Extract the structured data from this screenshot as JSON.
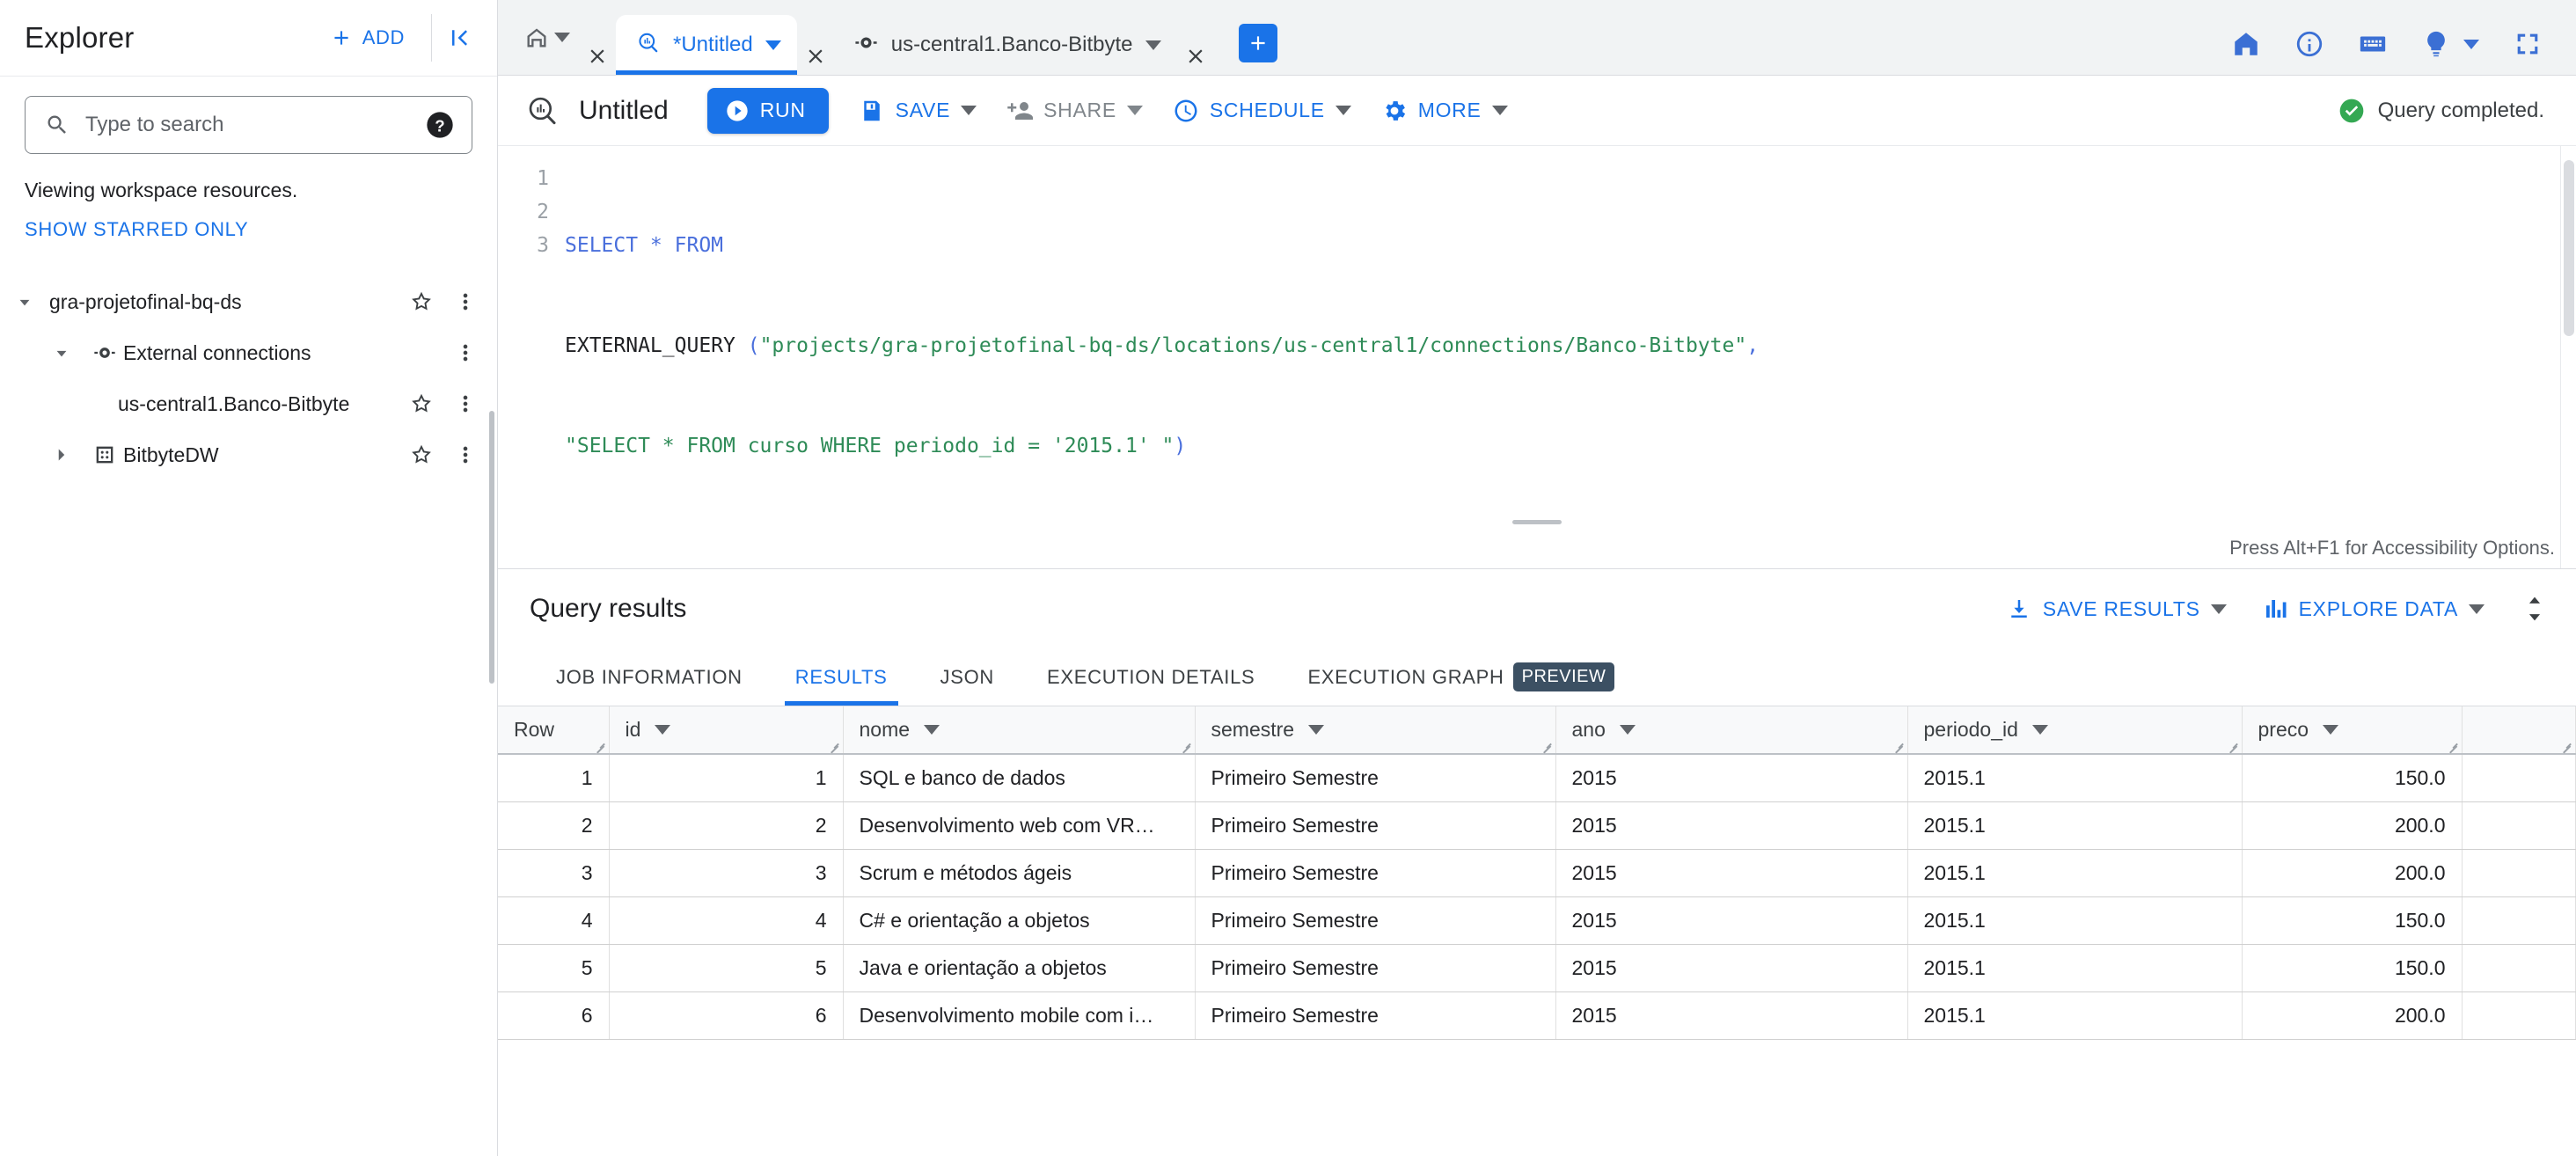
{
  "sidebar": {
    "title": "Explorer",
    "add_label": "ADD",
    "search_placeholder": "Type to search",
    "search_value": "",
    "viewing_note": "Viewing workspace resources.",
    "starred_link": "SHOW STARRED ONLY",
    "tree": [
      {
        "label": "gra-projetofinal-bq-ds",
        "icon": "chevron-down-icon",
        "expanded": true,
        "starred": true,
        "has_menu": true,
        "type": "project"
      },
      {
        "label": "External connections",
        "icon": "connection-icon",
        "expanded": true,
        "starred": false,
        "has_menu": true,
        "type": "folder"
      },
      {
        "label": "us-central1.Banco-Bitbyte",
        "icon": "none",
        "expanded": false,
        "starred": true,
        "has_menu": true,
        "type": "connection"
      },
      {
        "label": "BitbyteDW",
        "icon": "dataset-icon",
        "expanded": false,
        "starred": true,
        "has_menu": true,
        "type": "dataset"
      }
    ]
  },
  "tabstrip": {
    "home_tab_icon": "home-icon",
    "tabs": [
      {
        "label": "*Untitled",
        "icon": "query-icon",
        "active": true,
        "closable": true
      },
      {
        "label": "us-central1.Banco-Bitbyte",
        "icon": "connection-icon",
        "active": false,
        "closable": true
      }
    ],
    "new_tab_label": "+",
    "right_icons": [
      "home-icon",
      "info-icon",
      "keyboard-icon",
      "lightbulb-icon",
      "fullscreen-icon"
    ]
  },
  "toolbar": {
    "query_title": "Untitled",
    "run_label": "RUN",
    "save_label": "SAVE",
    "share_label": "SHARE",
    "schedule_label": "SCHEDULE",
    "more_label": "MORE",
    "status_text": "Query completed.",
    "status_color": "#34a853"
  },
  "editor": {
    "accessibility_hint": "Press Alt+F1 for Accessibility Options.",
    "lines": [
      {
        "num": "1",
        "text": "SELECT * FROM"
      },
      {
        "num": "2",
        "text": "EXTERNAL_QUERY (\"projects/gra-projetofinal-bq-ds/locations/us-central1/connections/Banco-Bitbyte\","
      },
      {
        "num": "3",
        "text": "\"SELECT * FROM curso WHERE periodo_id = '2015.1' \")"
      }
    ],
    "full_query": "SELECT * FROM\nEXTERNAL_QUERY (\"projects/gra-projetofinal-bq-ds/locations/us-central1/connections/Banco-Bitbyte\",\n\"SELECT * FROM curso WHERE periodo_id = '2015.1' \")"
  },
  "results": {
    "title": "Query results",
    "save_results_label": "SAVE RESULTS",
    "explore_data_label": "EXPLORE DATA",
    "tabs": [
      {
        "label": "JOB INFORMATION",
        "active": false,
        "badge": ""
      },
      {
        "label": "RESULTS",
        "active": true,
        "badge": ""
      },
      {
        "label": "JSON",
        "active": false,
        "badge": ""
      },
      {
        "label": "EXECUTION DETAILS",
        "active": false,
        "badge": ""
      },
      {
        "label": "EXECUTION GRAPH",
        "active": false,
        "badge": "PREVIEW"
      }
    ],
    "columns": [
      "Row",
      "id",
      "nome",
      "semestre",
      "ano",
      "periodo_id",
      "preco"
    ],
    "rows": [
      {
        "row": "1",
        "id": "1",
        "nome": "SQL e banco de dados",
        "semestre": "Primeiro Semestre",
        "ano": "2015",
        "periodo_id": "2015.1",
        "preco": "150.0"
      },
      {
        "row": "2",
        "id": "2",
        "nome": "Desenvolvimento web com VR…",
        "semestre": "Primeiro Semestre",
        "ano": "2015",
        "periodo_id": "2015.1",
        "preco": "200.0"
      },
      {
        "row": "3",
        "id": "3",
        "nome": "Scrum e métodos ágeis",
        "semestre": "Primeiro Semestre",
        "ano": "2015",
        "periodo_id": "2015.1",
        "preco": "200.0"
      },
      {
        "row": "4",
        "id": "4",
        "nome": "C# e orientação a objetos",
        "semestre": "Primeiro Semestre",
        "ano": "2015",
        "periodo_id": "2015.1",
        "preco": "150.0"
      },
      {
        "row": "5",
        "id": "5",
        "nome": "Java e orientação a objetos",
        "semestre": "Primeiro Semestre",
        "ano": "2015",
        "periodo_id": "2015.1",
        "preco": "150.0"
      },
      {
        "row": "6",
        "id": "6",
        "nome": "Desenvolvimento mobile com i…",
        "semestre": "Primeiro Semestre",
        "ano": "2015",
        "periodo_id": "2015.1",
        "preco": "200.0"
      }
    ]
  },
  "colors": {
    "accent": "#1a73e8",
    "success": "#34a853",
    "text": "#202124",
    "muted": "#5f6368",
    "string": "#2e8b57"
  }
}
